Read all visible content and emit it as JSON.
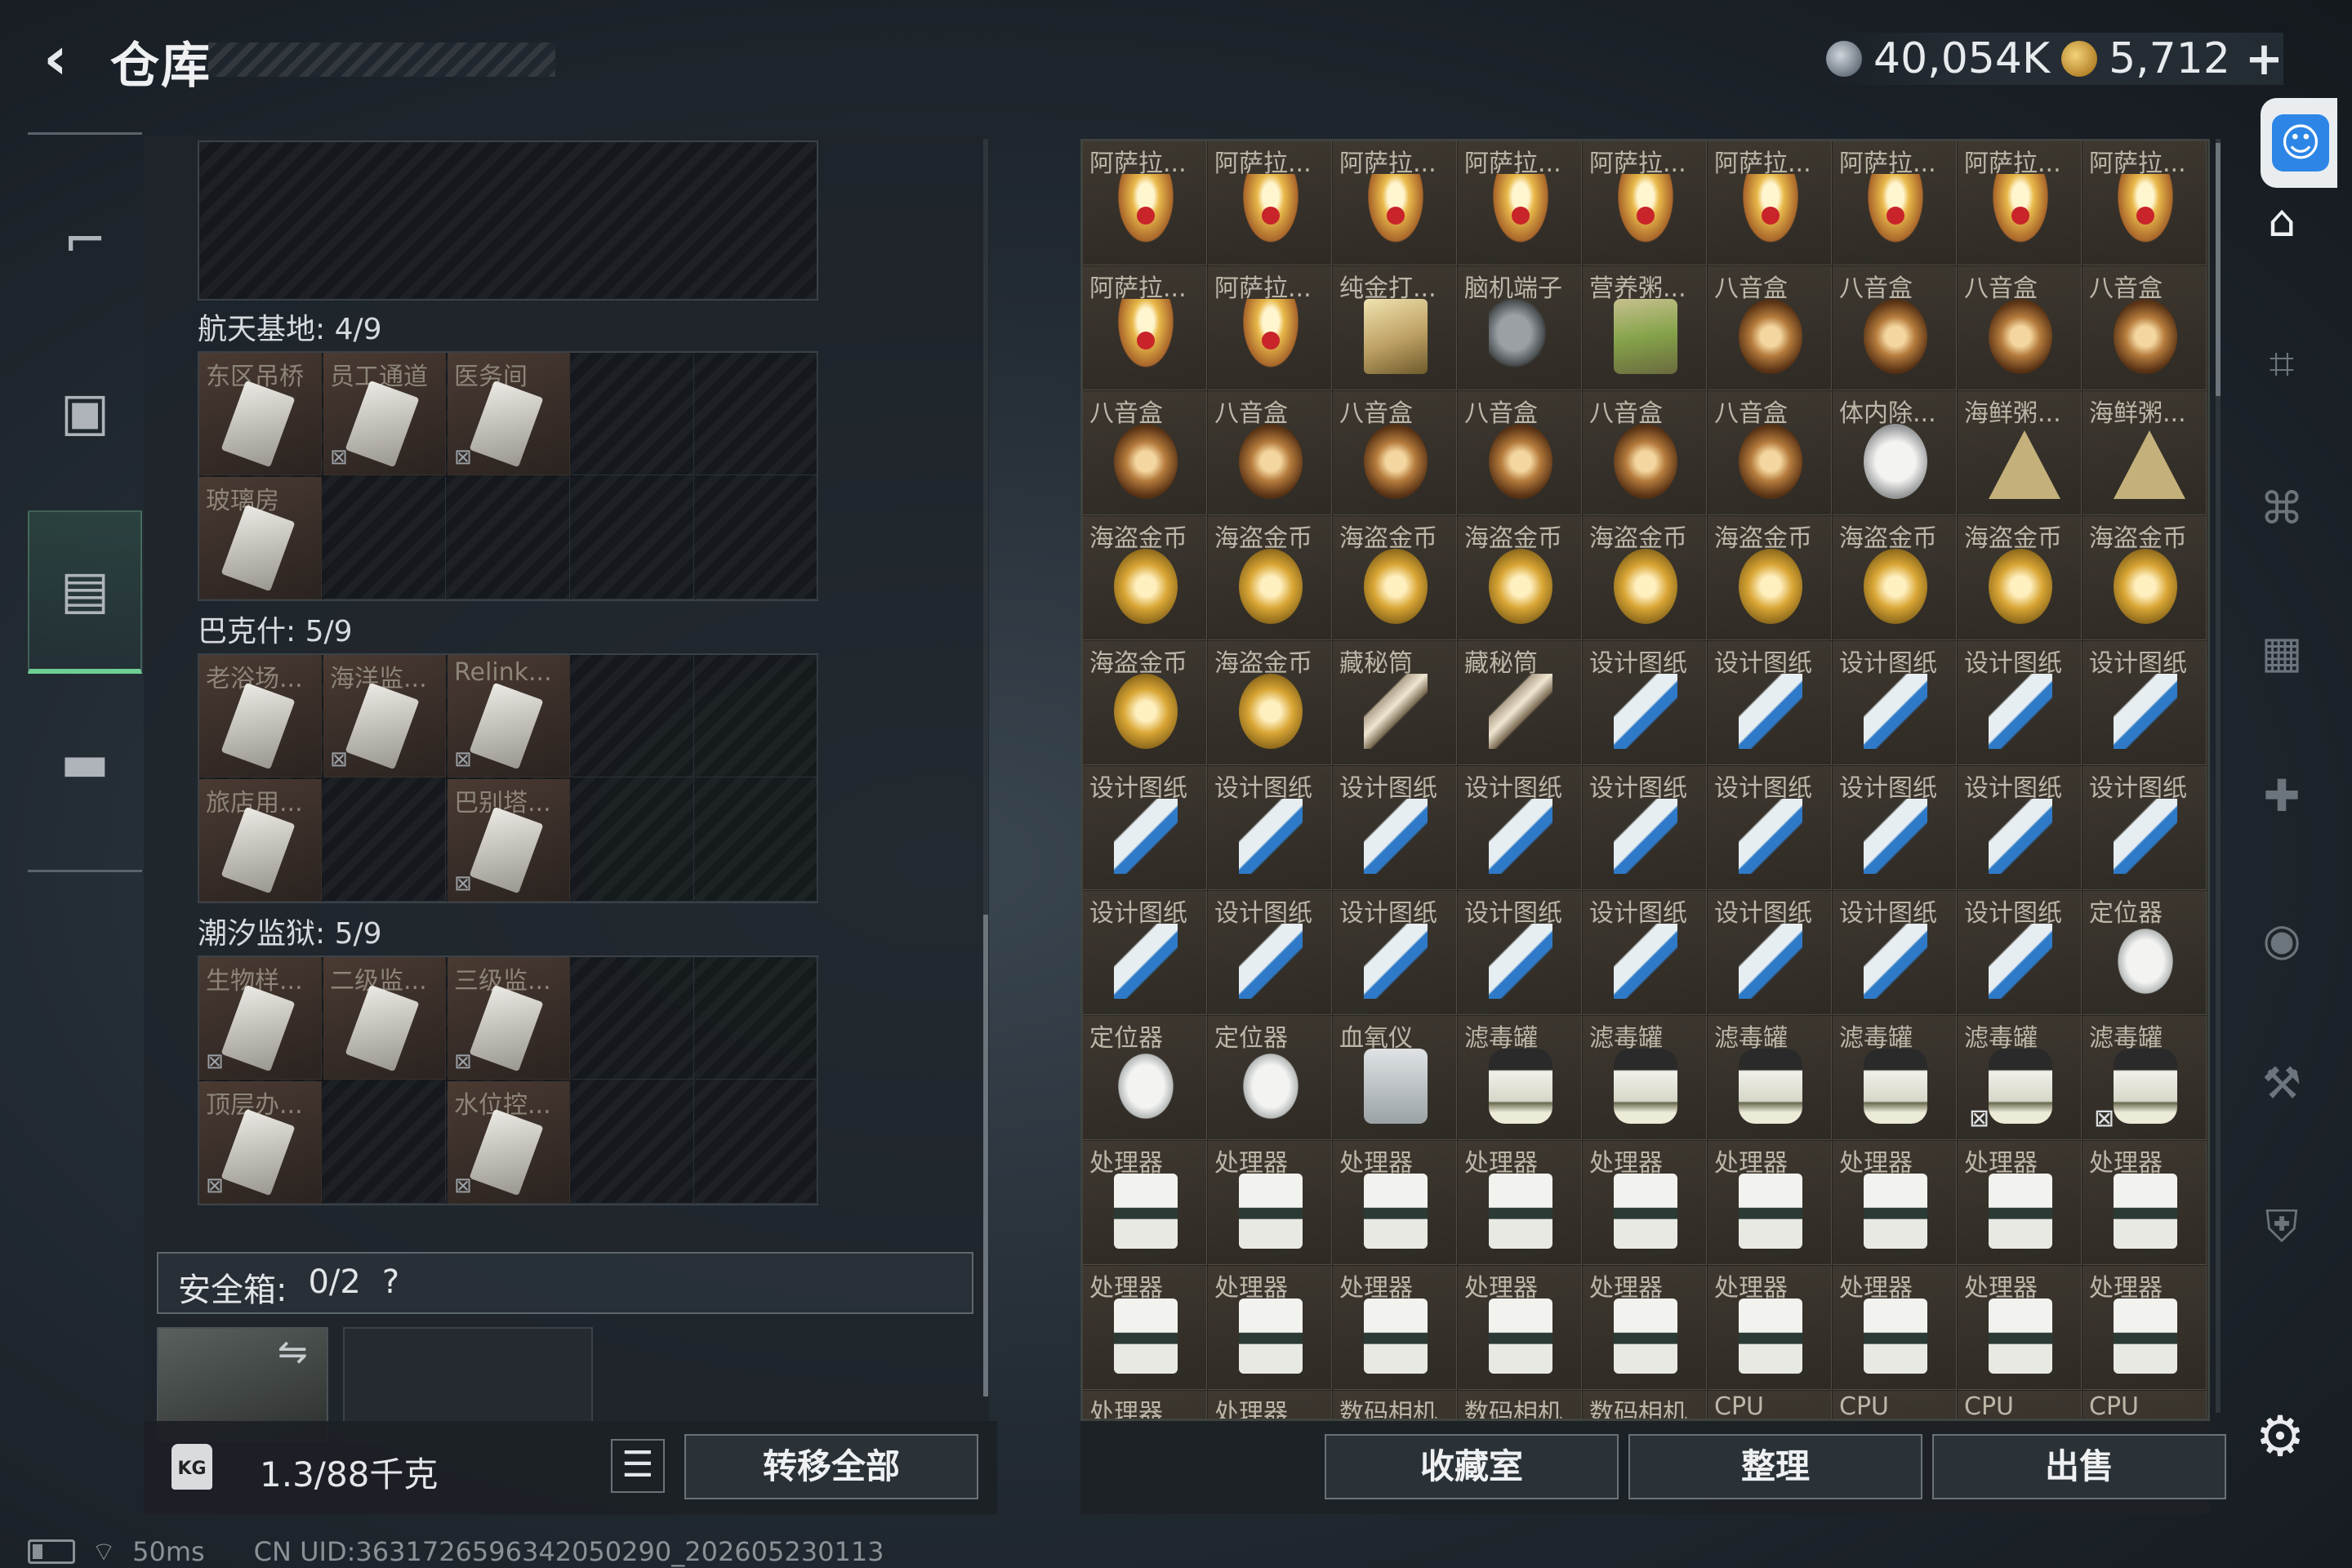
{
  "header": {
    "back_icon": "back-arrow-icon",
    "title": "仓库",
    "currency_silver": "40,054K",
    "currency_gold": "5,712",
    "plus": "+"
  },
  "left_nav": [
    {
      "icon": "pistol-icon"
    },
    {
      "icon": "backpack-icon"
    },
    {
      "icon": "clipboard-icon",
      "active": true
    },
    {
      "icon": "briefcase-icon"
    }
  ],
  "zones": [
    {
      "label": "",
      "cards": []
    },
    {
      "label": "航天基地: 4/9",
      "cards": [
        "东区吊桥",
        "员工通道",
        "医务间",
        "玻璃房"
      ]
    },
    {
      "label": "巴克什: 5/9",
      "cards": [
        "老浴场...",
        "海洋监...",
        "Relink...",
        "旅店用...",
        "巴别塔..."
      ]
    },
    {
      "label": "潮汐监狱: 5/9",
      "cards": [
        "生物样...",
        "二级监...",
        "三级监...",
        "顶层办...",
        "水位控..."
      ]
    }
  ],
  "safebox": {
    "label": "安全箱:",
    "count": "0/2",
    "help": "?"
  },
  "weight": {
    "icon": "KG",
    "value": "1.3",
    "capacity": "/88千克"
  },
  "buttons": {
    "list_icon": "list-icon",
    "transfer_all": "转移全部",
    "collection": "收藏室",
    "organize": "整理",
    "sell": "出售"
  },
  "storage": {
    "rows": [
      [
        "阿萨拉...",
        "阿萨拉...",
        "阿萨拉...",
        "阿萨拉...",
        "阿萨拉...",
        "阿萨拉...",
        "阿萨拉...",
        "阿萨拉...",
        "阿萨拉..."
      ],
      [
        "阿萨拉...",
        "阿萨拉...",
        "纯金打...",
        "脑机端子",
        "营养粥...",
        "八音盒",
        "八音盒",
        "八音盒",
        "八音盒"
      ],
      [
        "八音盒",
        "八音盒",
        "八音盒",
        "八音盒",
        "八音盒",
        "八音盒",
        "体内除...",
        "海鲜粥...",
        "海鲜粥..."
      ],
      [
        "海盗金币",
        "海盗金币",
        "海盗金币",
        "海盗金币",
        "海盗金币",
        "海盗金币",
        "海盗金币",
        "海盗金币",
        "海盗金币"
      ],
      [
        "海盗金币",
        "海盗金币",
        "藏秘筒",
        "藏秘筒",
        "设计图纸",
        "设计图纸",
        "设计图纸",
        "设计图纸",
        "设计图纸"
      ],
      [
        "设计图纸",
        "设计图纸",
        "设计图纸",
        "设计图纸",
        "设计图纸",
        "设计图纸",
        "设计图纸",
        "设计图纸",
        "设计图纸"
      ],
      [
        "设计图纸",
        "设计图纸",
        "设计图纸",
        "设计图纸",
        "设计图纸",
        "设计图纸",
        "设计图纸",
        "设计图纸",
        "定位器"
      ],
      [
        "定位器",
        "定位器",
        "血氧仪",
        "滤毒罐",
        "滤毒罐",
        "滤毒罐",
        "滤毒罐",
        "滤毒罐",
        "滤毒罐"
      ],
      [
        "处理器",
        "处理器",
        "处理器",
        "处理器",
        "处理器",
        "处理器",
        "处理器",
        "处理器",
        "处理器"
      ],
      [
        "处理器",
        "处理器",
        "处理器",
        "处理器",
        "处理器",
        "处理器",
        "处理器",
        "处理器",
        "处理器"
      ],
      [
        "处理器",
        "处理器",
        "数码相机",
        "数码相机",
        "数码相机",
        "CPU",
        "CPU",
        "CPU",
        "CPU"
      ]
    ]
  },
  "right_rail": [
    {
      "icon": "house-icon"
    },
    {
      "icon": "gti-gun-icon"
    },
    {
      "icon": "gti-rifle-icon"
    },
    {
      "icon": "iv-case-icon"
    },
    {
      "icon": "iv-medkit-icon"
    },
    {
      "icon": "v-camera-icon"
    },
    {
      "icon": "gti-tool-icon"
    },
    {
      "icon": "gti-armor-icon"
    }
  ],
  "settings_icon": "gear-icon",
  "status": {
    "ping": "50ms",
    "uid": "CN UID:3631726596342050290_202605230113"
  }
}
